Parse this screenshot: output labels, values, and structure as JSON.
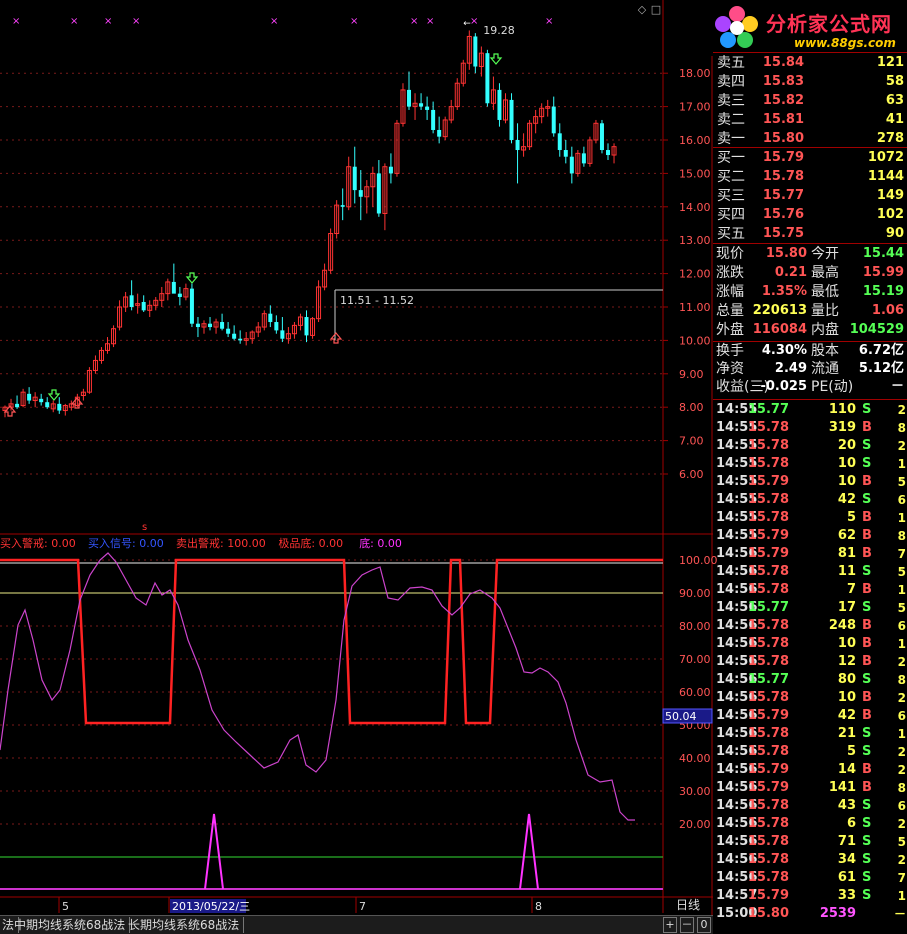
{
  "app": {
    "period_label": "日线",
    "corner_icons": [
      "◇",
      "□"
    ]
  },
  "logo": {
    "name": "分析家公式网",
    "url": "www.88gs.com"
  },
  "chart_data": [
    {
      "type": "candlestick",
      "y_ticks": [
        "18.00",
        "17.00",
        "16.00",
        "15.00",
        "14.00",
        "13.00",
        "12.00",
        "11.00",
        "10.00",
        "9.00",
        "8.00",
        "7.00",
        "6.00"
      ],
      "ylim": [
        5.5,
        19.8
      ],
      "x_labels": [
        "5",
        "2013/05/22/三",
        "7",
        "8"
      ],
      "annotations": {
        "max": "19.28",
        "range": "11.51 - 11.52",
        "top_mark": "s"
      },
      "candles": [
        [
          7.9,
          8.05,
          7.7,
          8.0
        ],
        [
          8.0,
          8.25,
          7.9,
          8.1
        ],
        [
          8.1,
          8.35,
          7.95,
          8.0
        ],
        [
          8.05,
          8.55,
          8.0,
          8.45
        ],
        [
          8.4,
          8.6,
          8.1,
          8.2
        ],
        [
          8.2,
          8.45,
          8.0,
          8.3
        ],
        [
          8.25,
          8.4,
          8.05,
          8.15
        ],
        [
          8.15,
          8.3,
          7.95,
          8.0
        ],
        [
          7.95,
          8.2,
          7.85,
          8.1
        ],
        [
          8.1,
          8.3,
          7.8,
          7.9
        ],
        [
          7.9,
          8.1,
          7.75,
          8.05
        ],
        [
          8.0,
          8.2,
          7.9,
          8.1
        ],
        [
          8.05,
          8.4,
          8.0,
          8.3
        ],
        [
          8.35,
          8.55,
          8.2,
          8.45
        ],
        [
          8.45,
          9.2,
          8.4,
          9.1
        ],
        [
          9.1,
          9.55,
          9.0,
          9.4
        ],
        [
          9.4,
          9.8,
          9.3,
          9.7
        ],
        [
          9.7,
          10.1,
          9.6,
          9.9
        ],
        [
          9.9,
          10.45,
          9.8,
          10.35
        ],
        [
          10.4,
          11.2,
          10.3,
          11.0
        ],
        [
          11.0,
          11.45,
          10.85,
          11.3
        ],
        [
          11.35,
          11.8,
          10.9,
          11.0
        ],
        [
          11.05,
          11.4,
          10.8,
          11.1
        ],
        [
          11.15,
          11.35,
          10.85,
          10.9
        ],
        [
          10.9,
          11.2,
          10.7,
          11.05
        ],
        [
          11.05,
          11.3,
          10.9,
          11.2
        ],
        [
          11.2,
          11.6,
          11.0,
          11.4
        ],
        [
          11.4,
          11.85,
          11.2,
          11.75
        ],
        [
          11.75,
          12.3,
          11.6,
          11.4
        ],
        [
          11.4,
          11.6,
          11.05,
          11.3
        ],
        [
          11.3,
          11.7,
          11.2,
          11.55
        ],
        [
          11.55,
          11.7,
          10.4,
          10.5
        ],
        [
          10.5,
          10.7,
          10.1,
          10.4
        ],
        [
          10.4,
          10.6,
          10.2,
          10.5
        ],
        [
          10.5,
          10.7,
          10.3,
          10.4
        ],
        [
          10.4,
          10.65,
          10.2,
          10.55
        ],
        [
          10.55,
          10.8,
          10.3,
          10.35
        ],
        [
          10.35,
          10.55,
          10.1,
          10.2
        ],
        [
          10.2,
          10.45,
          10.0,
          10.05
        ],
        [
          10.05,
          10.3,
          9.9,
          10.0
        ],
        [
          10.0,
          10.25,
          9.85,
          10.05
        ],
        [
          10.05,
          10.3,
          9.9,
          10.25
        ],
        [
          10.25,
          10.55,
          10.1,
          10.4
        ],
        [
          10.4,
          10.9,
          10.3,
          10.8
        ],
        [
          10.8,
          11.05,
          10.4,
          10.55
        ],
        [
          10.55,
          10.75,
          10.2,
          10.3
        ],
        [
          10.3,
          10.7,
          9.95,
          10.05
        ],
        [
          10.05,
          10.4,
          9.9,
          10.2
        ],
        [
          10.2,
          10.55,
          10.05,
          10.45
        ],
        [
          10.45,
          10.8,
          10.3,
          10.7
        ],
        [
          10.7,
          10.9,
          9.95,
          10.15
        ],
        [
          10.15,
          10.7,
          10.05,
          10.65
        ],
        [
          10.65,
          11.8,
          10.55,
          11.6
        ],
        [
          11.6,
          12.3,
          11.5,
          12.1
        ],
        [
          12.1,
          13.35,
          12.0,
          13.2
        ],
        [
          13.2,
          14.2,
          13.05,
          14.05
        ],
        [
          14.05,
          14.55,
          13.6,
          14.0
        ],
        [
          14.0,
          15.5,
          13.9,
          15.2
        ],
        [
          15.2,
          15.8,
          14.1,
          14.5
        ],
        [
          14.5,
          15.1,
          13.6,
          14.3
        ],
        [
          14.3,
          14.8,
          13.8,
          14.6
        ],
        [
          14.6,
          15.2,
          14.0,
          15.0
        ],
        [
          15.0,
          15.4,
          13.7,
          13.8
        ],
        [
          13.8,
          15.3,
          13.3,
          15.2
        ],
        [
          15.2,
          15.6,
          14.7,
          15.0
        ],
        [
          15.0,
          16.6,
          14.9,
          16.5
        ],
        [
          16.5,
          17.7,
          16.4,
          17.5
        ],
        [
          17.5,
          18.05,
          16.9,
          17.0
        ],
        [
          17.0,
          17.4,
          16.6,
          17.1
        ],
        [
          17.1,
          17.4,
          16.9,
          17.0
        ],
        [
          17.0,
          17.3,
          16.6,
          16.9
        ],
        [
          16.9,
          17.15,
          16.2,
          16.3
        ],
        [
          16.3,
          16.7,
          15.9,
          16.1
        ],
        [
          16.1,
          16.7,
          16.0,
          16.6
        ],
        [
          16.6,
          17.2,
          16.5,
          17.0
        ],
        [
          17.0,
          17.85,
          16.9,
          17.7
        ],
        [
          17.7,
          18.4,
          17.6,
          18.3
        ],
        [
          18.3,
          19.28,
          18.1,
          19.1
        ],
        [
          19.1,
          19.2,
          18.0,
          18.2
        ],
        [
          18.2,
          18.8,
          17.9,
          18.6
        ],
        [
          18.6,
          18.7,
          17.0,
          17.1
        ],
        [
          17.1,
          17.9,
          16.9,
          17.5
        ],
        [
          17.5,
          17.7,
          16.4,
          16.6
        ],
        [
          16.6,
          17.4,
          16.5,
          17.2
        ],
        [
          17.2,
          17.4,
          15.9,
          16.0
        ],
        [
          16.0,
          16.5,
          14.7,
          15.7
        ],
        [
          15.7,
          16.2,
          15.5,
          15.8
        ],
        [
          15.8,
          16.6,
          15.7,
          16.5
        ],
        [
          16.5,
          16.9,
          16.2,
          16.7
        ],
        [
          16.7,
          17.1,
          16.5,
          16.95
        ],
        [
          16.95,
          17.2,
          16.7,
          17.0
        ],
        [
          17.0,
          17.3,
          16.1,
          16.2
        ],
        [
          16.2,
          16.5,
          15.5,
          15.7
        ],
        [
          15.7,
          16.0,
          15.3,
          15.5
        ],
        [
          15.5,
          15.8,
          14.7,
          15.0
        ],
        [
          15.0,
          15.7,
          14.9,
          15.6
        ],
        [
          15.6,
          15.8,
          15.2,
          15.3
        ],
        [
          15.3,
          16.1,
          15.2,
          16.0
        ],
        [
          16.0,
          16.6,
          15.9,
          16.5
        ],
        [
          16.5,
          16.6,
          15.6,
          15.7
        ],
        [
          15.7,
          15.9,
          15.4,
          15.55
        ],
        [
          15.55,
          15.9,
          15.3,
          15.8
        ]
      ]
    },
    {
      "type": "line",
      "y_ticks": [
        "100.00",
        "90.00",
        "80.00",
        "70.00",
        "60.00",
        "50.00",
        "40.00",
        "30.00",
        "20.00"
      ],
      "ylim": [
        0,
        112
      ],
      "current_value": "50.04",
      "legend": [
        {
          "label": "买入警戒:",
          "value": "0.00",
          "color": "#ff3333"
        },
        {
          "label": "买入信号:",
          "value": "0.00",
          "color": "#3355ff"
        },
        {
          "label": "卖出警戒:",
          "value": "100.00",
          "color": "#ff3333"
        },
        {
          "label": "极品底:",
          "value": "0.00",
          "color": "#ff3333"
        },
        {
          "label": "底:",
          "value": "0.00",
          "color": "#ff33ff"
        }
      ]
    }
  ],
  "quotes": {
    "sells": [
      {
        "label": "卖五",
        "price": "15.84",
        "vol": "121"
      },
      {
        "label": "卖四",
        "price": "15.83",
        "vol": "58"
      },
      {
        "label": "卖三",
        "price": "15.82",
        "vol": "63"
      },
      {
        "label": "卖二",
        "price": "15.81",
        "vol": "41"
      },
      {
        "label": "卖一",
        "price": "15.80",
        "vol": "278"
      }
    ],
    "buys": [
      {
        "label": "买一",
        "price": "15.79",
        "vol": "1072"
      },
      {
        "label": "买二",
        "price": "15.78",
        "vol": "1144"
      },
      {
        "label": "买三",
        "price": "15.77",
        "vol": "149"
      },
      {
        "label": "买四",
        "price": "15.76",
        "vol": "102"
      },
      {
        "label": "买五",
        "price": "15.75",
        "vol": "90"
      }
    ]
  },
  "stats": [
    {
      "l1": "现价",
      "v1": "15.80",
      "c1": "#ff5555",
      "l2": "今开",
      "v2": "15.44",
      "c2": "#55ff55"
    },
    {
      "l1": "涨跌",
      "v1": "0.21",
      "c1": "#ff5555",
      "l2": "最高",
      "v2": "15.99",
      "c2": "#ff5555"
    },
    {
      "l1": "涨幅",
      "v1": "1.35%",
      "c1": "#ff5555",
      "l2": "最低",
      "v2": "15.19",
      "c2": "#55ff55"
    },
    {
      "l1": "总量",
      "v1": "220613",
      "c1": "#ffff55",
      "l2": "量比",
      "v2": "1.06",
      "c2": "#ff5555"
    },
    {
      "l1": "外盘",
      "v1": "116084",
      "c1": "#ff5555",
      "l2": "内盘",
      "v2": "104529",
      "c2": "#55ff55"
    }
  ],
  "stats2": [
    {
      "l1": "换手",
      "v1": "4.30%",
      "l2": "股本",
      "v2": "6.72亿"
    },
    {
      "l1": "净资",
      "v1": "2.49",
      "l2": "流通",
      "v2": "5.12亿"
    },
    {
      "l1": "收益(三)",
      "v1": "-0.025",
      "l2": "PE(动)",
      "v2": "－"
    }
  ],
  "ticks": [
    {
      "t": "14:55",
      "p": "15.77",
      "v": "110",
      "s": "S",
      "n": "2"
    },
    {
      "t": "14:55",
      "p": "15.78",
      "v": "319",
      "s": "B",
      "n": "8"
    },
    {
      "t": "14:55",
      "p": "15.78",
      "v": "20",
      "s": "S",
      "n": "2"
    },
    {
      "t": "14:55",
      "p": "15.78",
      "v": "10",
      "s": "S",
      "n": "1"
    },
    {
      "t": "14:55",
      "p": "15.79",
      "v": "10",
      "s": "B",
      "n": "5"
    },
    {
      "t": "14:55",
      "p": "15.78",
      "v": "42",
      "s": "S",
      "n": "6"
    },
    {
      "t": "14:55",
      "p": "15.78",
      "v": "5",
      "s": "B",
      "n": "1"
    },
    {
      "t": "14:55",
      "p": "15.79",
      "v": "62",
      "s": "B",
      "n": "8"
    },
    {
      "t": "14:56",
      "p": "15.79",
      "v": "81",
      "s": "B",
      "n": "7"
    },
    {
      "t": "14:56",
      "p": "15.78",
      "v": "11",
      "s": "S",
      "n": "5"
    },
    {
      "t": "14:56",
      "p": "15.78",
      "v": "7",
      "s": "B",
      "n": "1"
    },
    {
      "t": "14:56",
      "p": "15.77",
      "v": "17",
      "s": "S",
      "n": "5"
    },
    {
      "t": "14:56",
      "p": "15.78",
      "v": "248",
      "s": "B",
      "n": "6"
    },
    {
      "t": "14:56",
      "p": "15.78",
      "v": "10",
      "s": "B",
      "n": "1"
    },
    {
      "t": "14:56",
      "p": "15.78",
      "v": "12",
      "s": "B",
      "n": "2"
    },
    {
      "t": "14:56",
      "p": "15.77",
      "v": "80",
      "s": "S",
      "n": "8"
    },
    {
      "t": "14:56",
      "p": "15.78",
      "v": "10",
      "s": "B",
      "n": "2"
    },
    {
      "t": "14:56",
      "p": "15.79",
      "v": "42",
      "s": "B",
      "n": "6"
    },
    {
      "t": "14:56",
      "p": "15.78",
      "v": "21",
      "s": "S",
      "n": "1"
    },
    {
      "t": "14:56",
      "p": "15.78",
      "v": "5",
      "s": "S",
      "n": "2"
    },
    {
      "t": "14:56",
      "p": "15.79",
      "v": "14",
      "s": "B",
      "n": "2"
    },
    {
      "t": "14:56",
      "p": "15.79",
      "v": "141",
      "s": "B",
      "n": "8"
    },
    {
      "t": "14:56",
      "p": "15.78",
      "v": "43",
      "s": "S",
      "n": "6"
    },
    {
      "t": "14:56",
      "p": "15.78",
      "v": "6",
      "s": "S",
      "n": "2"
    },
    {
      "t": "14:56",
      "p": "15.78",
      "v": "71",
      "s": "S",
      "n": "5"
    },
    {
      "t": "14:56",
      "p": "15.78",
      "v": "34",
      "s": "S",
      "n": "2"
    },
    {
      "t": "14:56",
      "p": "15.78",
      "v": "61",
      "s": "S",
      "n": "7"
    },
    {
      "t": "14:57",
      "p": "15.79",
      "v": "33",
      "s": "S",
      "n": "1"
    },
    {
      "t": "15:00",
      "p": "15.80",
      "v": "2539",
      "s": "",
      "n": "－"
    }
  ],
  "tabs": [
    "法",
    "中期均线系统68战法",
    "长期均线系统68战法"
  ],
  "tab_controls": [
    "+",
    "－",
    "0"
  ]
}
